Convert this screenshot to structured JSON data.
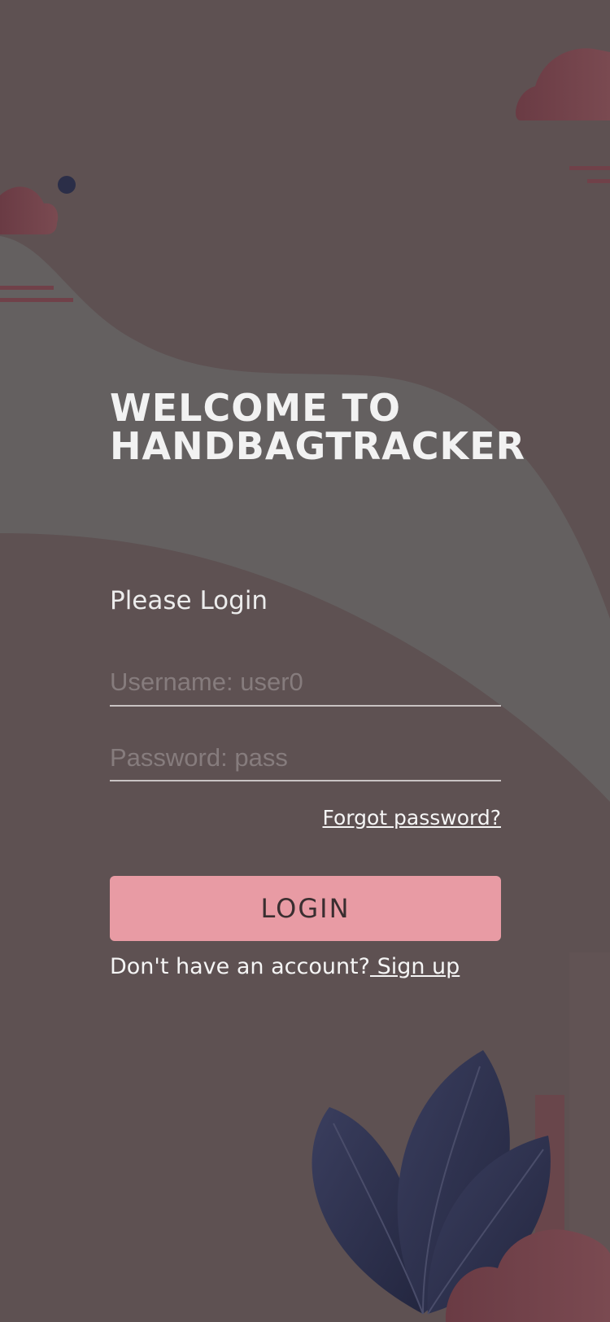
{
  "app": {
    "title": "WELCOME TO HANDBAGTRACKER",
    "subtitle": "Please Login"
  },
  "form": {
    "username_placeholder": "Username: user0",
    "password_placeholder": "Password: pass",
    "forgot_label": "Forgot password?",
    "login_label": "LOGIN",
    "signup_prompt": "Don't have an account?",
    "signup_label": " Sign up"
  },
  "colors": {
    "background": "#5e5152",
    "wave_light": "#646060",
    "accent_button": "#e89ba4",
    "cloud": "#6e4149",
    "leaf": "#2b2f4d"
  }
}
